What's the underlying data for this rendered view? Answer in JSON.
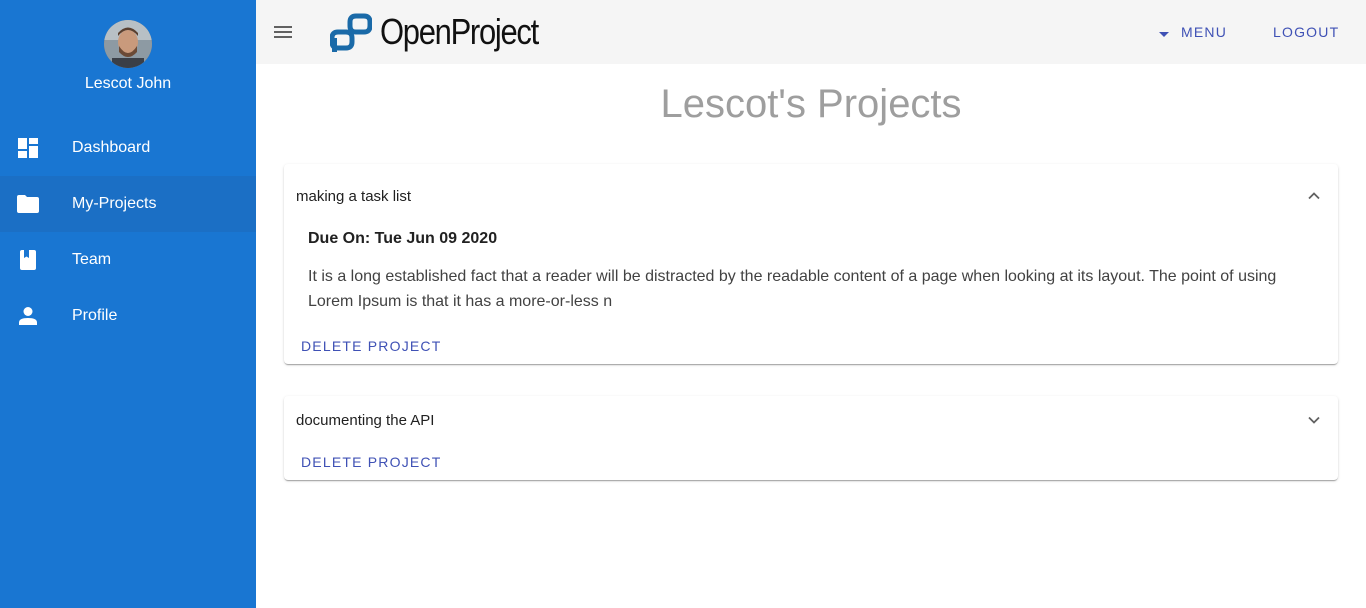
{
  "user": {
    "name": "Lescot John"
  },
  "sidebar": {
    "items": [
      {
        "label": "Dashboard",
        "icon": "dashboard-icon"
      },
      {
        "label": "My-Projects",
        "icon": "folder-icon",
        "active": true
      },
      {
        "label": "Team",
        "icon": "book-icon"
      },
      {
        "label": "Profile",
        "icon": "person-icon"
      }
    ]
  },
  "header": {
    "logo_text": "OpenProject",
    "menu_label": "MENU",
    "logout_label": "LOGOUT"
  },
  "main": {
    "title": "Lescot's Projects",
    "projects": [
      {
        "title": "making a task list",
        "expanded": true,
        "due": "Due On: Tue Jun 09 2020",
        "description": "It is a long established fact that a reader will be distracted by the readable content of a page when looking at its layout. The point of using Lorem Ipsum is that it has a more-or-less n",
        "delete_label": "DELETE PROJECT"
      },
      {
        "title": "documenting the API",
        "expanded": false,
        "delete_label": "DELETE PROJECT"
      }
    ]
  },
  "colors": {
    "sidebar": "#1976d2",
    "accent": "#3f51b5",
    "title_gray": "#9e9e9e",
    "appbar": "#f5f5f5"
  }
}
